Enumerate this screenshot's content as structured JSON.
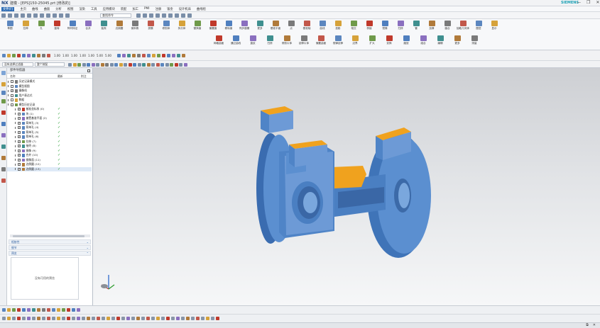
{
  "app": {
    "logo": "NX",
    "title": "建模 - [EPS]150-25045.prt  [修改的]",
    "brand": "SIEMENS",
    "window_controls": [
      "—",
      "❐",
      "✕"
    ]
  },
  "menu": {
    "items": [
      "文件(F)",
      "主页",
      "曲线",
      "曲面",
      "分析",
      "视图",
      "渲染",
      "工具",
      "应用模块",
      "装配",
      "加工",
      "PMI",
      "注册",
      "钣金",
      "设计机床",
      "曲线组"
    ]
  },
  "quick_access": {
    "search_value": "查找命令"
  },
  "ribbon": {
    "row1": [
      "草图",
      "拉伸",
      "孔",
      "旋转",
      "阵列特征",
      "合并",
      "抽壳",
      "边倒圆",
      "倒斜角",
      "拔模",
      "修剪体",
      "拆分体",
      "替换面",
      "偏置面",
      "移除面",
      "同步建模",
      "更多",
      "基准平面",
      "点",
      "基准轴",
      "曲线",
      "投影",
      "相交",
      "桥接",
      "镜像",
      "扫掠",
      "管",
      "加厚",
      "缝合",
      "抽取几何体",
      "图层",
      "显示"
    ],
    "row2": [
      "网格曲面",
      "通过曲线",
      "直纹",
      "扫掠",
      "修剪片体",
      "延伸片体",
      "偏置曲面",
      "规律延伸",
      "边界",
      "扩大",
      "变换",
      "缩放",
      "组合",
      "编辑",
      "更多",
      "测量"
    ]
  },
  "toolbar1": {
    "numbers": [
      "1.00",
      "1.00",
      "1.00",
      "1.00",
      "1.00",
      "5.00",
      "5.00"
    ]
  },
  "toolbar2": {
    "filter_value": "没有选择过滤器",
    "scope_value": "整个装配"
  },
  "navigator": {
    "title": "部件导航器",
    "col_name": "名称",
    "col_latest": "最新",
    "col_note": "附注",
    "rows": [
      {
        "label": "历史记录模式",
        "checked": false,
        "ok": false
      },
      {
        "label": "模型视图",
        "checked": false,
        "ok": false
      },
      {
        "label": "摄像机",
        "checked": true,
        "ok": false
      },
      {
        "label": "用户表达式",
        "checked": false,
        "ok": false
      },
      {
        "label": "数据",
        "checked": false,
        "ok": false
      },
      {
        "label": "模型历史记录",
        "checked": false,
        "ok": false
      },
      {
        "label": "基准坐标系 (0)",
        "checked": true,
        "ok": true
      },
      {
        "label": "块 (1)",
        "checked": true,
        "ok": true
      },
      {
        "label": "偏置基准平面 (2)",
        "checked": true,
        "ok": true
      },
      {
        "label": "简单孔 (3)",
        "checked": true,
        "ok": true
      },
      {
        "label": "简单孔 (4)",
        "checked": true,
        "ok": true
      },
      {
        "label": "简单孔 (5)",
        "checked": true,
        "ok": true
      },
      {
        "label": "简单孔 (6)",
        "checked": true,
        "ok": true
      },
      {
        "label": "拉伸 (7)",
        "checked": true,
        "ok": true
      },
      {
        "label": "抽壳 (8)",
        "checked": true,
        "ok": true
      },
      {
        "label": "镜像 (9)",
        "checked": true,
        "ok": true
      },
      {
        "label": "合并 (10)",
        "checked": true,
        "ok": true
      },
      {
        "label": "镜像面 (11)",
        "checked": true,
        "ok": true
      },
      {
        "label": "边倒圆 (12)",
        "checked": true,
        "ok": true
      },
      {
        "label": "边倒圆 (13)",
        "checked": true,
        "ok": true
      }
    ],
    "panels": [
      "相依性",
      "细节",
      "预览"
    ],
    "preview_message": "没有可用的预览"
  },
  "status": {
    "right": [
      "⧉",
      "✕"
    ]
  },
  "colors": {
    "model_blue": "#5b8fd0",
    "model_orange": "#f0a21e",
    "accent": "#2f6db5",
    "check": "#1f9a2a"
  }
}
